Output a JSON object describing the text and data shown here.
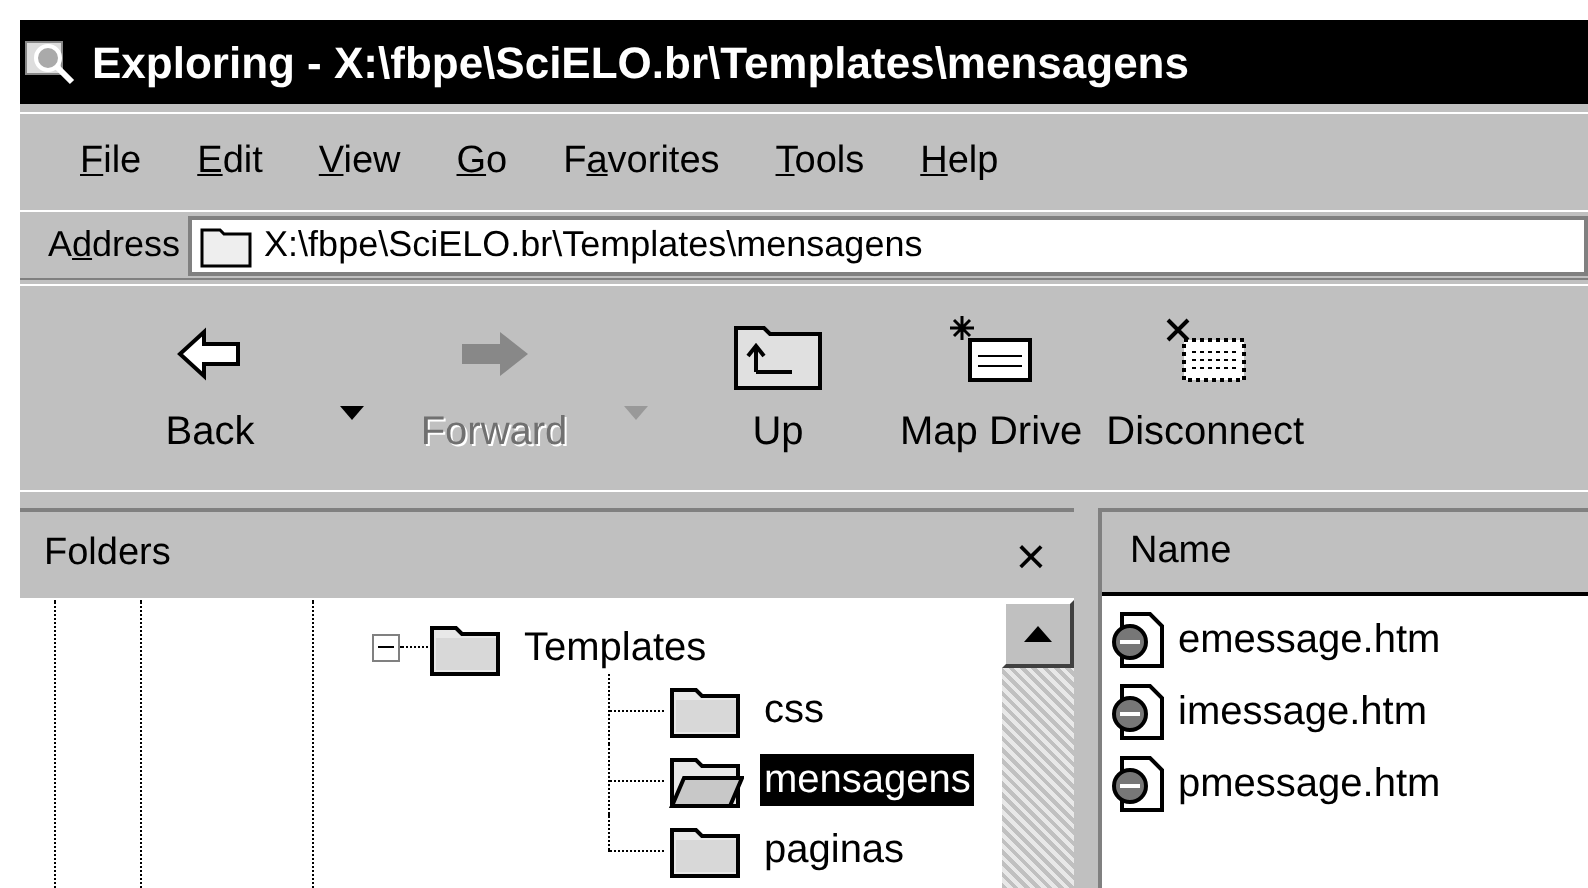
{
  "window": {
    "title": "Exploring - X:\\fbpe\\SciELO.br\\Templates\\mensagens"
  },
  "menu": [
    {
      "key": "F",
      "post": "ile"
    },
    {
      "key": "E",
      "post": "dit"
    },
    {
      "key": "V",
      "post": "iew"
    },
    {
      "key": "G",
      "post": "o"
    },
    {
      "pre": "F",
      "key": "a",
      "post": "vorites"
    },
    {
      "key": "T",
      "post": "ools"
    },
    {
      "key": "H",
      "post": "elp"
    }
  ],
  "address": {
    "label": {
      "pre": "A",
      "key": "d",
      "post": "dress"
    },
    "value": "X:\\fbpe\\SciELO.br\\Templates\\mensagens"
  },
  "toolbar": [
    {
      "kind": "back",
      "label": "Back",
      "disabled": false,
      "dropdown": true
    },
    {
      "kind": "forward",
      "label": "Forward",
      "disabled": true,
      "dropdown": true
    },
    {
      "kind": "up",
      "label": "Up",
      "disabled": false,
      "dropdown": false
    },
    {
      "kind": "map",
      "label": "Map Drive",
      "disabled": false,
      "dropdown": false
    },
    {
      "kind": "disconnect",
      "label": "Disconnect",
      "disabled": false,
      "dropdown": false
    }
  ],
  "folders": {
    "title": "Folders",
    "close": "×",
    "tree": [
      {
        "label": "Templates",
        "expanded": true,
        "selected": false,
        "children": [
          {
            "label": "css",
            "selected": false
          },
          {
            "label": "mensagens",
            "selected": true
          },
          {
            "label": "paginas",
            "selected": false
          }
        ]
      }
    ]
  },
  "files": {
    "columns": [
      "Name"
    ],
    "items": [
      {
        "name": "emessage.htm"
      },
      {
        "name": "imessage.htm"
      },
      {
        "name": "pmessage.htm"
      }
    ]
  }
}
